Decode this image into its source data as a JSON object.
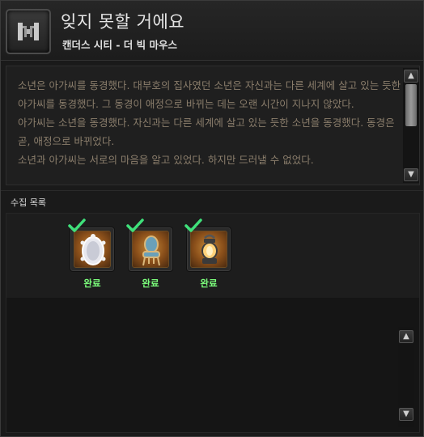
{
  "header": {
    "title": "잊지 못할 거에요",
    "subtitle": "캔더스 시티 - 더 빅 마우스",
    "emblem_icon": "gate-emblem-icon"
  },
  "description": {
    "text": "소년은 아가씨를 동경했다. 대부호의 집사였던 소년은 자신과는 다른 세계에 살고 있는 듯한 아가씨를 동경했다. 그 동경이 애정으로 바뀌는 데는 오랜 시간이 지나지 않았다.\n아가씨는 소년을 동경했다. 자신과는 다른 세계에 살고 있는 듯한 소년을 동경했다. 동경은 곧, 애정으로 바뀌었다.\n소년과 아가씨는 서로의 마음을 알고 있었다. 하지만 드러낼 수 없었다."
  },
  "collection": {
    "label": "수집 목록",
    "items": [
      {
        "icon": "ornate-mirror-icon",
        "status": "완료"
      },
      {
        "icon": "antique-chair-icon",
        "status": "완료"
      },
      {
        "icon": "lantern-icon",
        "status": "완료"
      }
    ]
  },
  "colors": {
    "description_text": "#8a7d6b",
    "complete_text": "#7cff7c",
    "check_mark": "#3fe07a"
  }
}
